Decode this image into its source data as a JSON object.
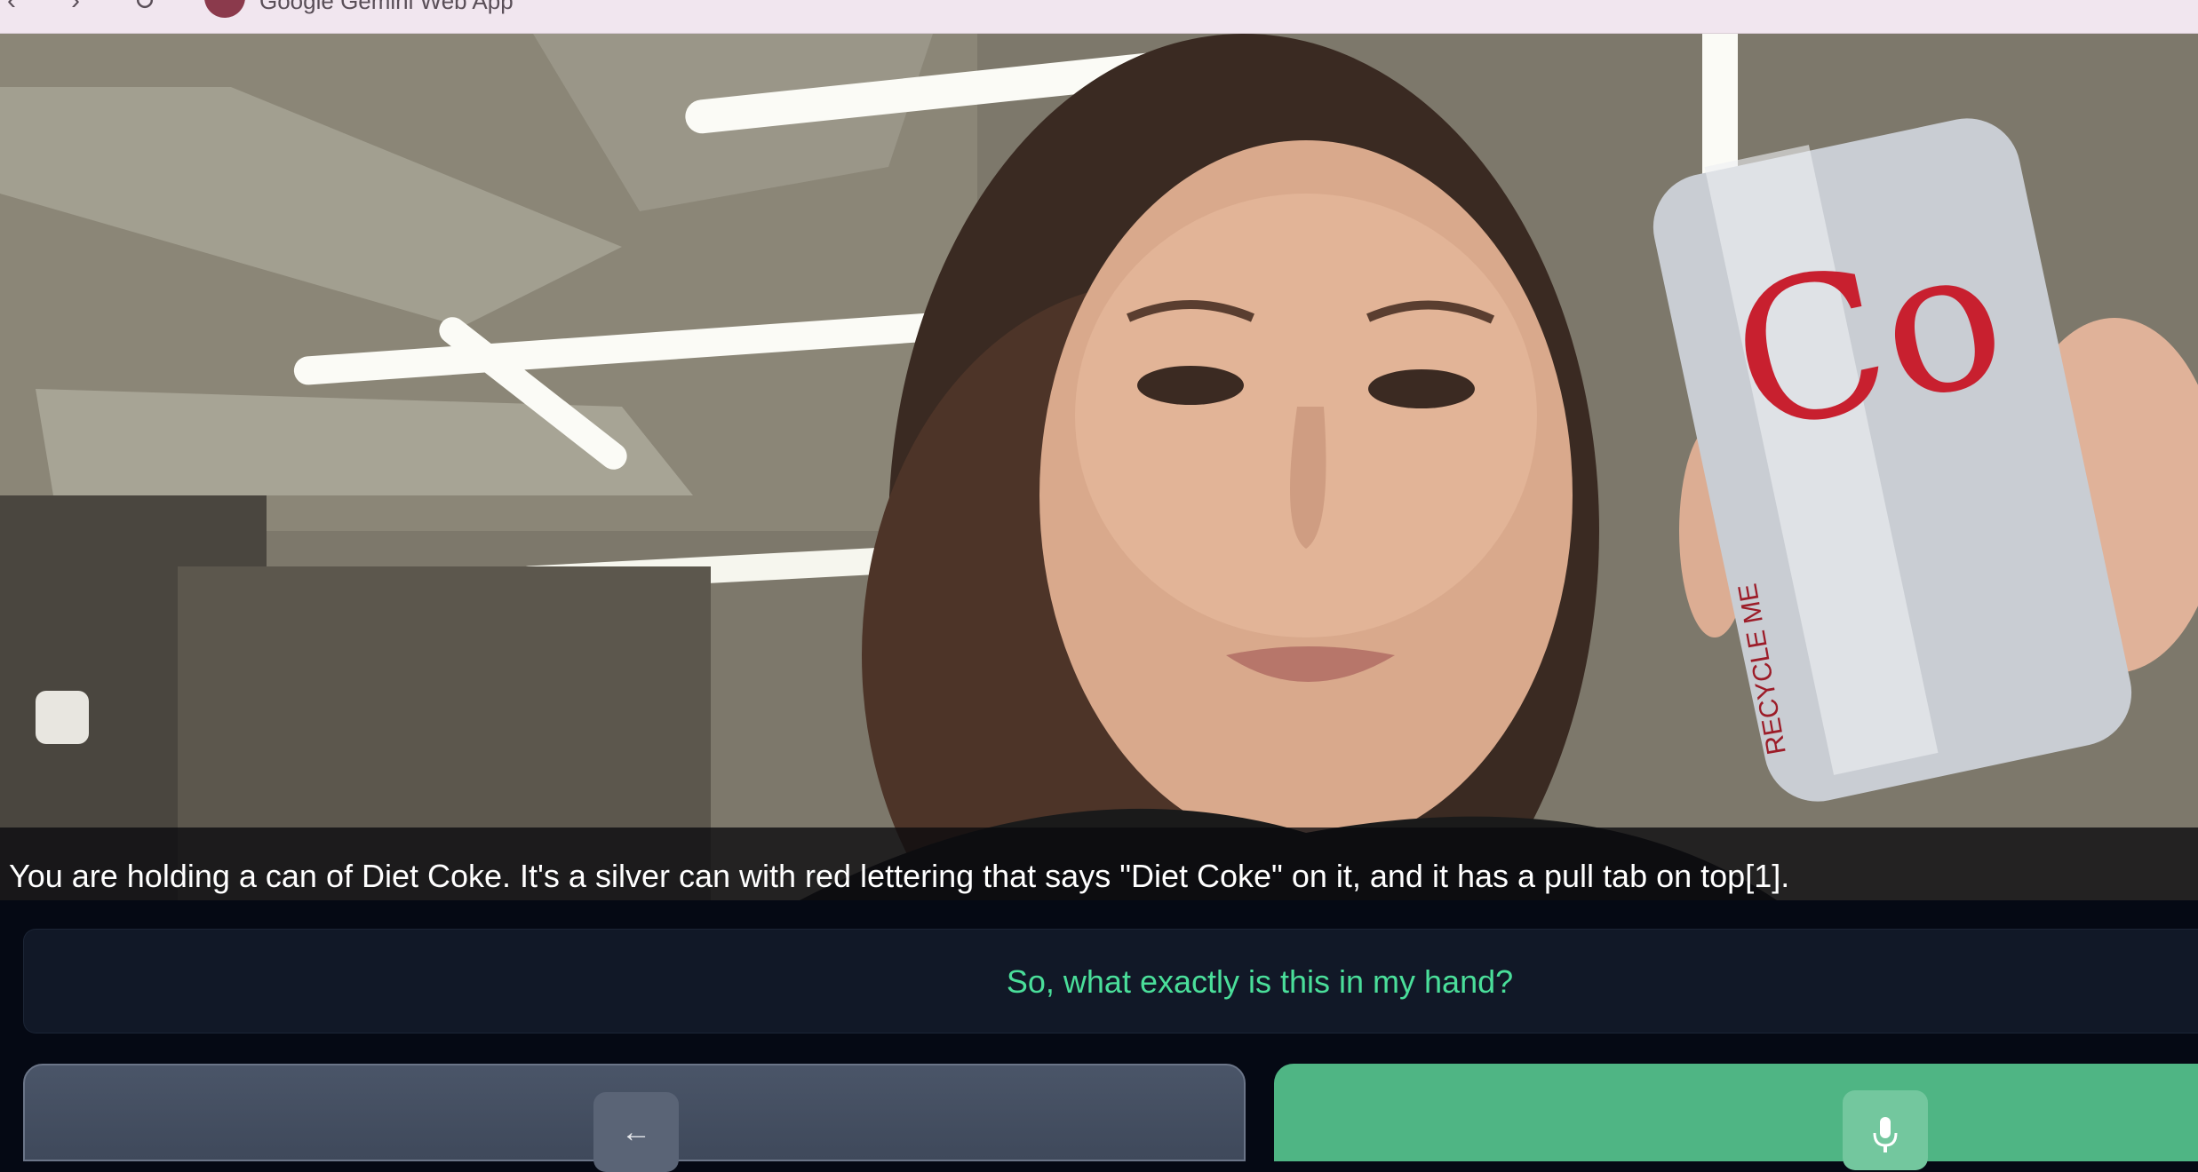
{
  "browser": {
    "tab_title": "Google Gemini Web App",
    "theme_color": "#f1e6ef"
  },
  "camera": {
    "caption": "You are holding a can of Diet Coke. It's a silver can with red lettering that says \"Diet Coke\" on it, and it has a pull tab on top[1].",
    "image_description": "Selfie camera feed: person holding a silver Diet Coke can under office ceiling lights"
  },
  "transcript": {
    "text": "So, what exactly is this in my hand?",
    "color": "#4ade9a"
  },
  "controls": {
    "back_icon": "arrow-left-icon",
    "mic_icon": "microphone-icon",
    "back_color": "#4a5568",
    "mic_color": "#4fb584"
  }
}
